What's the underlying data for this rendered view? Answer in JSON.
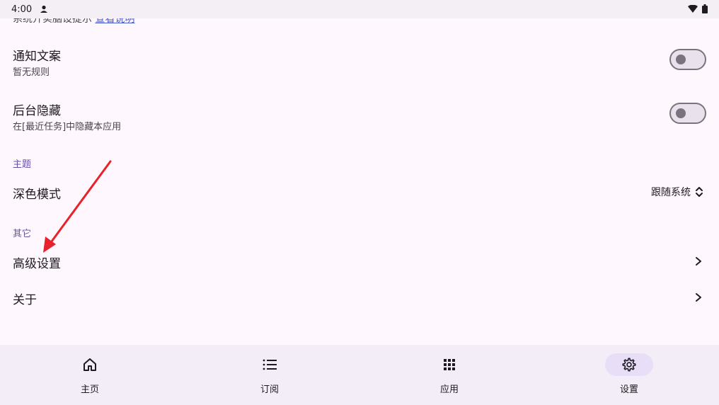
{
  "status_bar": {
    "time": "4:00"
  },
  "cutoff_row": {
    "text": "系统开实脑设提示",
    "link": "查看说明"
  },
  "rows": [
    {
      "title": "通知文案",
      "subtitle": "暂无规则",
      "toggle_on": false
    },
    {
      "title": "后台隐藏",
      "subtitle": "在[最近任务]中隐藏本应用",
      "toggle_on": false
    }
  ],
  "sections": {
    "theme": "主题",
    "other": "其它"
  },
  "dark_mode": {
    "title": "深色模式",
    "value": "跟随系统"
  },
  "advanced": {
    "title": "高级设置"
  },
  "about": {
    "title": "关于"
  },
  "nav": [
    {
      "label": "主页",
      "icon": "home-icon"
    },
    {
      "label": "订阅",
      "icon": "list-icon"
    },
    {
      "label": "应用",
      "icon": "apps-grid-icon"
    },
    {
      "label": "设置",
      "icon": "gear-icon"
    }
  ],
  "active_nav": "设置",
  "colors": {
    "accent": "#6750A4",
    "background": "#FFF7FE",
    "nav_bg": "#F3EDF7",
    "annotation_arrow": "#E8222A"
  }
}
